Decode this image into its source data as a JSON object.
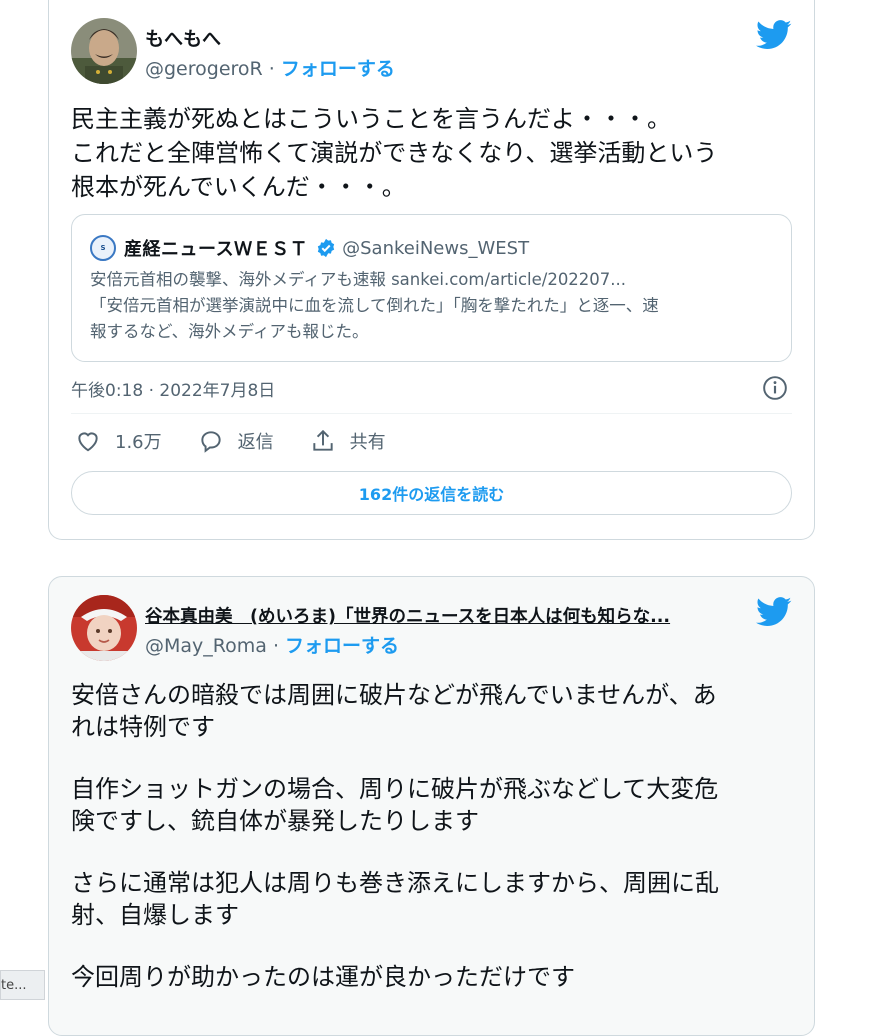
{
  "tweet1": {
    "name": "もへもへ",
    "handle": "@gerogeroR",
    "sep": " · ",
    "follow": "フォローする",
    "text_lines": [
      "民主主義が死ぬとはこういうことを言うんだよ・・・。",
      "これだと全陣営怖くて演説ができなくなり、選挙活動という",
      "根本が死んでいくんだ・・・。"
    ],
    "quote": {
      "name": "産経ニュースＷＥＳＴ",
      "handle": "@SankeiNews_WEST",
      "lines": [
        "安倍元首相の襲撃、海外メディアも速報 sankei.com/article/202207...",
        "「安倍元首相が選挙演説中に血を流して倒れた」「胸を撃たれた」と逐一、速",
        "報するなど、海外メディアも報じた。"
      ]
    },
    "timestamp": "午後0:18 · 2022年7月8日",
    "likes": "1.6万",
    "reply_label": "返信",
    "share_label": "共有",
    "read_replies": "162件の返信を読む"
  },
  "tweet2": {
    "name": "谷本真由美　(めいろま)「世界のニュースを日本人は何も知らな...",
    "handle": "@May_Roma",
    "sep": " · ",
    "follow": "フォローする",
    "paragraphs": [
      [
        "安倍さんの暗殺では周囲に破片などが飛んでいませんが、あ",
        "れは特例です"
      ],
      [
        "自作ショットガンの場合、周りに破片が飛ぶなどして大変危",
        "険ですし、銃自体が暴発したりします"
      ],
      [
        "さらに通常は犯人は周りも巻き添えにしますから、周囲に乱",
        "射、自爆します"
      ],
      [
        "今回周りが助かったのは運が良かっただけです"
      ]
    ]
  },
  "bottom_chip": "te...",
  "colors": {
    "accent": "#1d9bf0",
    "text": "#0f1419",
    "muted": "#536471",
    "border": "#cfd9de"
  }
}
